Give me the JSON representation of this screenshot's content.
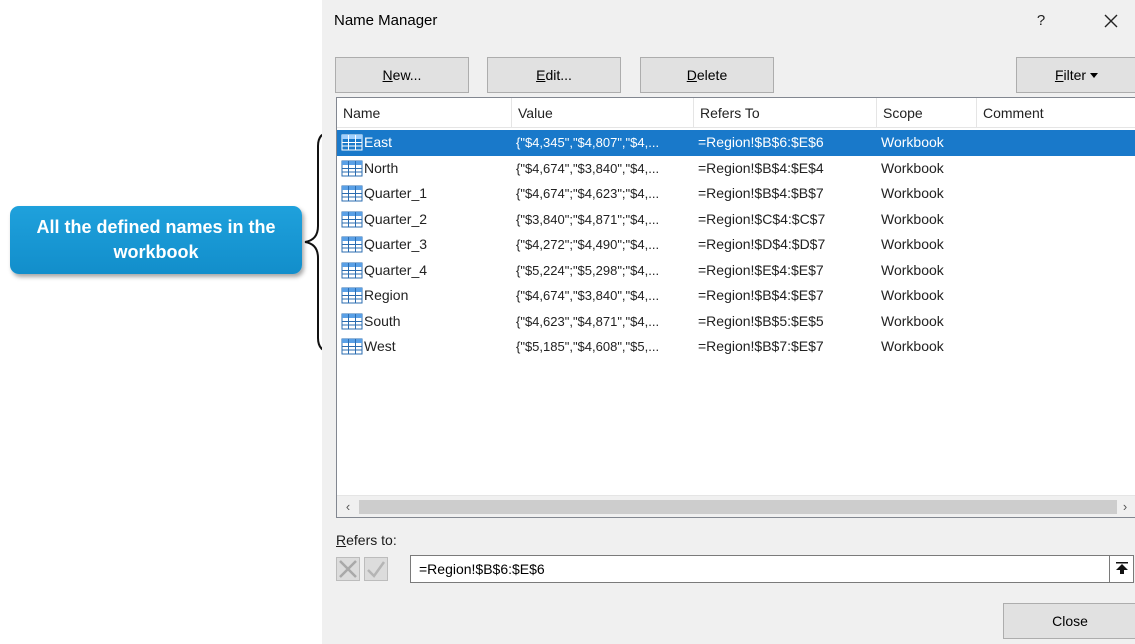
{
  "callout": {
    "text": "All the defined names in the workbook"
  },
  "dialog": {
    "title": "Name Manager",
    "help": "?",
    "buttons": {
      "new": {
        "accel": "N",
        "rest": "ew..."
      },
      "edit": {
        "accel": "E",
        "rest": "dit..."
      },
      "delete": {
        "accel": "D",
        "rest": "elete"
      },
      "filter": {
        "accel": "F",
        "rest": "ilter"
      },
      "close": "Close"
    },
    "columns": [
      "Name",
      "Value",
      "Refers To",
      "Scope",
      "Comment"
    ],
    "rows": [
      {
        "name": "East",
        "value": "{\"$4,345\",\"$4,807\",\"$4,...",
        "refers_to": "=Region!$B$6:$E$6",
        "scope": "Workbook",
        "comment": "",
        "selected": true
      },
      {
        "name": "North",
        "value": "{\"$4,674\",\"$3,840\",\"$4,...",
        "refers_to": "=Region!$B$4:$E$4",
        "scope": "Workbook",
        "comment": ""
      },
      {
        "name": "Quarter_1",
        "value": "{\"$4,674\";\"$4,623\";\"$4,...",
        "refers_to": "=Region!$B$4:$B$7",
        "scope": "Workbook",
        "comment": ""
      },
      {
        "name": "Quarter_2",
        "value": "{\"$3,840\";\"$4,871\";\"$4,...",
        "refers_to": "=Region!$C$4:$C$7",
        "scope": "Workbook",
        "comment": ""
      },
      {
        "name": "Quarter_3",
        "value": "{\"$4,272\";\"$4,490\";\"$4,...",
        "refers_to": "=Region!$D$4:$D$7",
        "scope": "Workbook",
        "comment": ""
      },
      {
        "name": "Quarter_4",
        "value": "{\"$5,224\";\"$5,298\";\"$4,...",
        "refers_to": "=Region!$E$4:$E$7",
        "scope": "Workbook",
        "comment": ""
      },
      {
        "name": "Region",
        "value": "{\"$4,674\",\"$3,840\",\"$4,...",
        "refers_to": "=Region!$B$4:$E$7",
        "scope": "Workbook",
        "comment": ""
      },
      {
        "name": "South",
        "value": "{\"$4,623\",\"$4,871\",\"$4,...",
        "refers_to": "=Region!$B$5:$E$5",
        "scope": "Workbook",
        "comment": ""
      },
      {
        "name": "West",
        "value": "{\"$5,185\",\"$4,608\",\"$5,...",
        "refers_to": "=Region!$B$7:$E$7",
        "scope": "Workbook",
        "comment": ""
      }
    ],
    "refers_to": {
      "label_accel": "R",
      "label_rest": "efers to:",
      "value": "=Region!$B$6:$E$6"
    },
    "icons": {
      "row_icon": "table-icon",
      "close": "close-icon",
      "collapse": "collapse-dialog-icon"
    },
    "colors": {
      "selection": "#1979ca",
      "callout": "#1a96d4"
    }
  }
}
